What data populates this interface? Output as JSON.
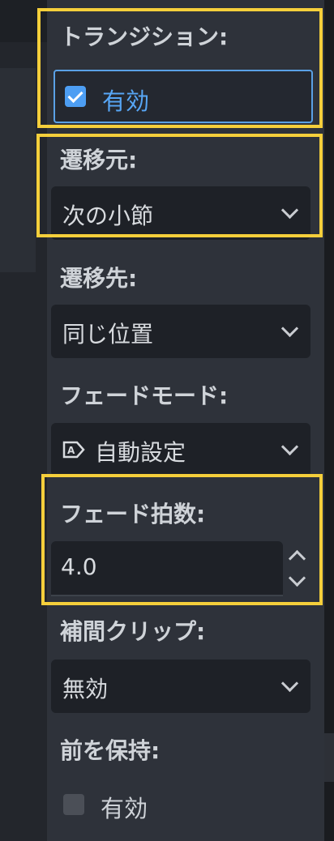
{
  "transition": {
    "label": "トランジション:",
    "enabled_label": "有効",
    "enabled": true
  },
  "source": {
    "label": "遷移元:",
    "value": "次の小節"
  },
  "destination": {
    "label": "遷移先:",
    "value": "同じ位置"
  },
  "fade_mode": {
    "label": "フェードモード:",
    "value": "自動設定",
    "icon": "auto-fade-icon"
  },
  "fade_beats": {
    "label": "フェード拍数:",
    "value": "4.0"
  },
  "interpolation_clip": {
    "label": "補間クリップ:",
    "value": "無効"
  },
  "keep_previous": {
    "label": "前を保持:",
    "enabled_label": "有効",
    "enabled": false
  },
  "colors": {
    "panel_bg": "#2e323a",
    "field_bg": "#1e2127",
    "accent_blue": "#4d9ef3",
    "highlight": "#f5cf3b"
  }
}
